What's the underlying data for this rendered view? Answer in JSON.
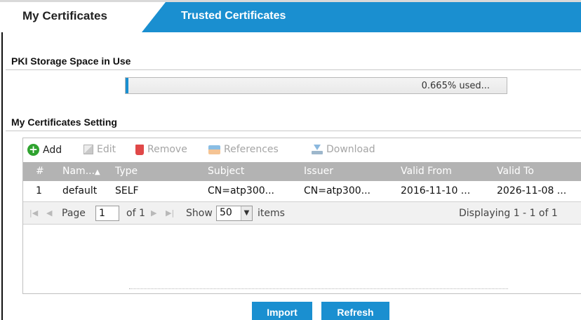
{
  "tabs": [
    {
      "label": "My Certificates",
      "active": true
    },
    {
      "label": "Trusted Certificates",
      "active": false
    }
  ],
  "storage": {
    "title": "PKI Storage Space in Use",
    "percent_used": 0.665,
    "text": "0.665% used..."
  },
  "settings": {
    "title": "My Certificates Setting",
    "toolbar": {
      "add": "Add",
      "edit": "Edit",
      "remove": "Remove",
      "references": "References",
      "download": "Download"
    },
    "columns": [
      "#",
      "Nam...",
      "Type",
      "Subject",
      "Issuer",
      "Valid From",
      "Valid To"
    ],
    "sort_indicator": "▲",
    "rows": [
      {
        "num": "1",
        "name": "default",
        "type": "SELF",
        "subject": "CN=atp300...",
        "issuer": "CN=atp300...",
        "valid_from": "2016-11-10 ...",
        "valid_to": "2026-11-08 ..."
      }
    ],
    "pager": {
      "page_label": "Page",
      "page": "1",
      "of_label": "of 1",
      "show_label": "Show",
      "page_size": "50",
      "items_label": "items",
      "display_text": "Displaying 1 - 1 of 1"
    }
  },
  "buttons": {
    "import": "Import",
    "refresh": "Refresh"
  },
  "colors": {
    "accent": "#1a8fd0",
    "header_gray": "#b3b3b3"
  }
}
